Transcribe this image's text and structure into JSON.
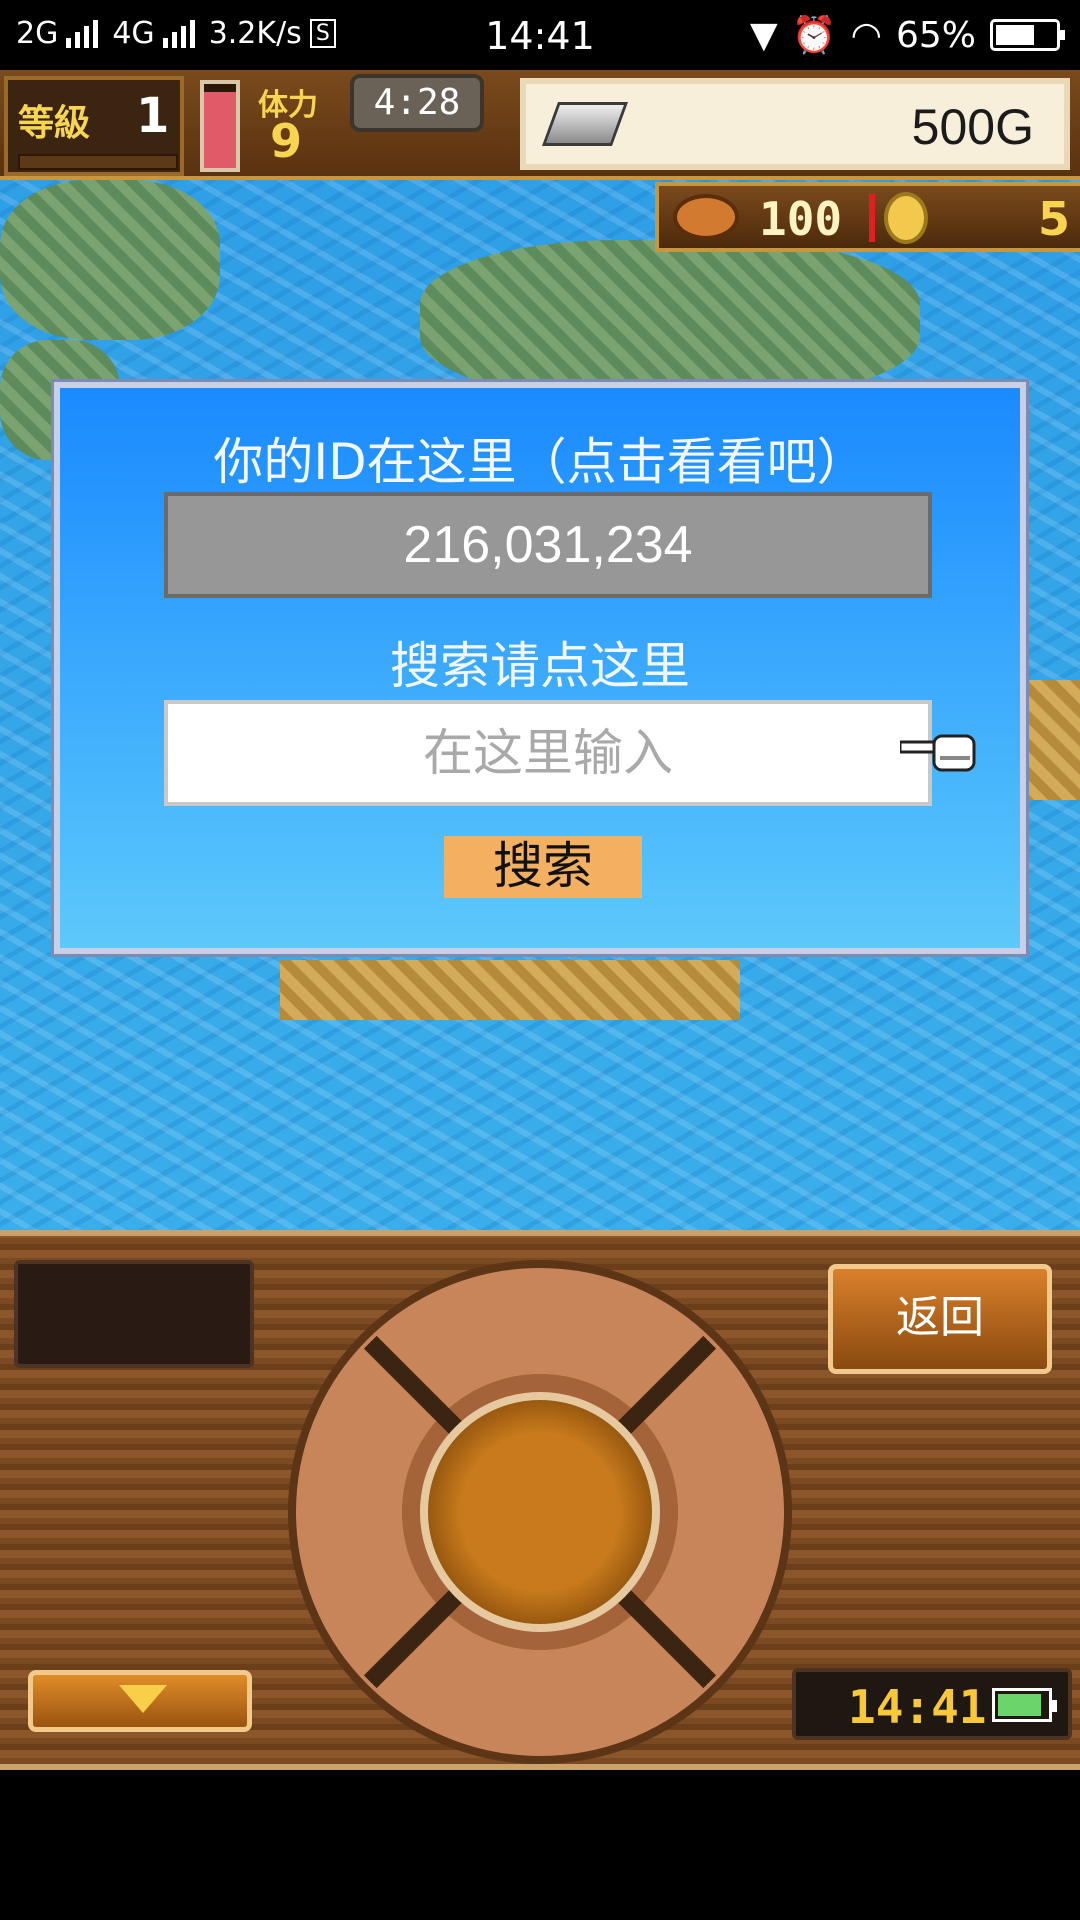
{
  "status_bar": {
    "network_1": "2G",
    "network_2": "4G",
    "speed": "3.2K/s",
    "sim_badge": "S",
    "time": "14:41",
    "battery_percent": "65%",
    "icons": [
      "signal-icon",
      "location-icon",
      "alarm-icon",
      "wifi-icon",
      "battery-icon"
    ]
  },
  "hud": {
    "level_label": "等級",
    "level_value": "1",
    "hp_fill_fraction": 0.9,
    "stamina_label": "体力",
    "stamina_value": "9",
    "timer": "4:28",
    "gold": "500G",
    "food": "100",
    "medals": "5"
  },
  "dialog": {
    "title": "你的ID在这里（点击看看吧）",
    "id_value": "216,031,234",
    "search_hint": "搜索请点这里",
    "input_placeholder": "在这里输入",
    "search_button": "搜索"
  },
  "controls": {
    "back_button": "返回",
    "clock": "14:41"
  },
  "colors": {
    "dialog_top": "#1a8aff",
    "dialog_bottom": "#5cc9fb",
    "search_button": "#f2b060",
    "id_box": "#979797"
  }
}
